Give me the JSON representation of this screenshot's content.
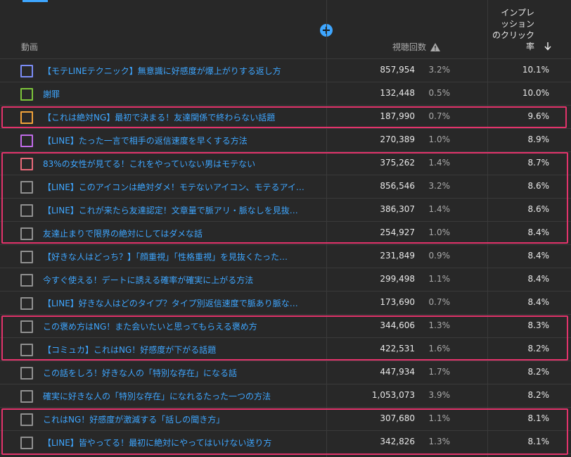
{
  "header": {
    "video_label": "動画",
    "views_label": "視聴回数",
    "ctr_label_lines": [
      "インプレ",
      "ッション",
      "のクリック",
      "率"
    ],
    "add_label": "+"
  },
  "colors": {
    "accent": "#3ea6ff",
    "highlight": "#e2336b",
    "checkbox_default": "#909090"
  },
  "rows": [
    {
      "title": "【モテLINEテクニック】無意識に好感度が爆上がりする返し方",
      "views": "857,954",
      "pct": "3.2%",
      "ctr": "10.1%",
      "color": "#7b8cf5"
    },
    {
      "title": "謝罪",
      "views": "132,448",
      "pct": "0.5%",
      "ctr": "10.0%",
      "color": "#7cc43a"
    },
    {
      "title": "【これは絶対NG】最初で決まる！友達関係で終わらない話題",
      "views": "187,990",
      "pct": "0.7%",
      "ctr": "9.6%",
      "color": "#f0a23a"
    },
    {
      "title": "【LINE】たった一言で相手の返信速度を早くする方法",
      "views": "270,389",
      "pct": "1.0%",
      "ctr": "8.9%",
      "color": "#c06be8"
    },
    {
      "title": "83%の女性が見てる！これをやっていない男はモテない",
      "views": "375,262",
      "pct": "1.4%",
      "ctr": "8.7%",
      "color": "#e86a7a"
    },
    {
      "title": "【LINE】このアイコンは絶対ダメ！モテないアイコン、モテるアイ…",
      "views": "856,546",
      "pct": "3.2%",
      "ctr": "8.6%",
      "color": "#909090"
    },
    {
      "title": "【LINE】これが来たら友達認定！文章量で脈アリ・脈なしを見抜…",
      "views": "386,307",
      "pct": "1.4%",
      "ctr": "8.6%",
      "color": "#909090"
    },
    {
      "title": "友達止まりで限界の絶対にしてはダメな話",
      "views": "254,927",
      "pct": "1.0%",
      "ctr": "8.4%",
      "color": "#909090"
    },
    {
      "title": "【好きな人はどっち？】「顔重視」「性格重視」を見抜くたった…",
      "views": "231,849",
      "pct": "0.9%",
      "ctr": "8.4%",
      "color": "#909090"
    },
    {
      "title": "今すぐ使える！デートに誘える確率が確実に上がる方法",
      "views": "299,498",
      "pct": "1.1%",
      "ctr": "8.4%",
      "color": "#909090"
    },
    {
      "title": "【LINE】好きな人はどのタイプ？タイプ別返信速度で脈あり脈な…",
      "views": "173,690",
      "pct": "0.7%",
      "ctr": "8.4%",
      "color": "#909090"
    },
    {
      "title": "この褒め方はNG！また会いたいと思ってもらえる褒め方",
      "views": "344,606",
      "pct": "1.3%",
      "ctr": "8.3%",
      "color": "#909090"
    },
    {
      "title": "【コミュカ】これはNG！好感度が下がる話題",
      "views": "422,531",
      "pct": "1.6%",
      "ctr": "8.2%",
      "color": "#909090"
    },
    {
      "title": "この話をしろ！好きな人の「特別な存在」になる話",
      "views": "447,934",
      "pct": "1.7%",
      "ctr": "8.2%",
      "color": "#909090"
    },
    {
      "title": "確実に好きな人の「特別な存在」になれるたった一つの方法",
      "views": "1,053,073",
      "pct": "3.9%",
      "ctr": "8.2%",
      "color": "#909090"
    },
    {
      "title": "これはNG！好感度が激減する「話しの聞き方」",
      "views": "307,680",
      "pct": "1.1%",
      "ctr": "8.1%",
      "color": "#909090"
    },
    {
      "title": "【LINE】皆やってる！最初に絶対にやってはいけない送り方",
      "views": "342,826",
      "pct": "1.3%",
      "ctr": "8.1%",
      "color": "#909090"
    }
  ]
}
